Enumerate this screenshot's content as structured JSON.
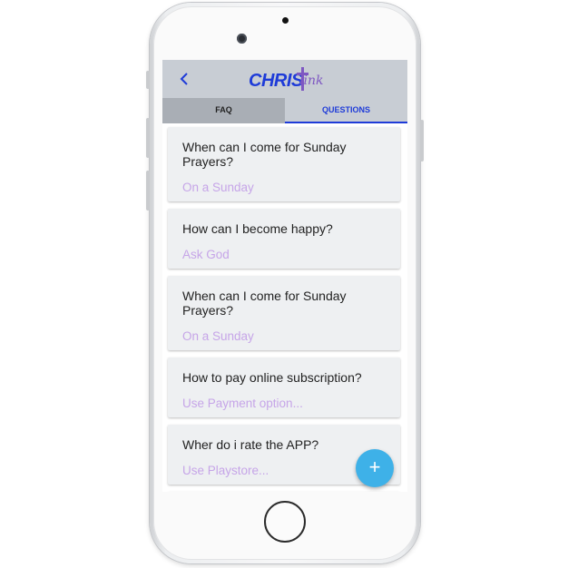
{
  "appbar": {
    "logo_main": "CHRIS",
    "logo_script": "link",
    "back_icon": "chevron-left-icon"
  },
  "tabs": [
    {
      "label": "FAQ",
      "active": false
    },
    {
      "label": "QUESTIONS",
      "active": true
    }
  ],
  "questions": [
    {
      "question": "When can I come for Sunday Prayers?",
      "answer": "On a Sunday"
    },
    {
      "question": "How can I become happy?",
      "answer": "Ask God"
    },
    {
      "question": "When can I come for Sunday Prayers?",
      "answer": "On a Sunday"
    },
    {
      "question": "How to pay online subscription?",
      "answer": "Use Payment option..."
    },
    {
      "question": "Wher do i rate the APP?",
      "answer": "Use Playstore..."
    }
  ],
  "fab": {
    "symbol": "+",
    "icon": "plus-icon"
  },
  "colors": {
    "accent": "#1e3bd8",
    "appbar": "#c8cdd4",
    "tabbar": "#a9aeb5",
    "answer": "#c6a5e8",
    "fab": "#3eb1e8",
    "card": "#eef0f2"
  }
}
